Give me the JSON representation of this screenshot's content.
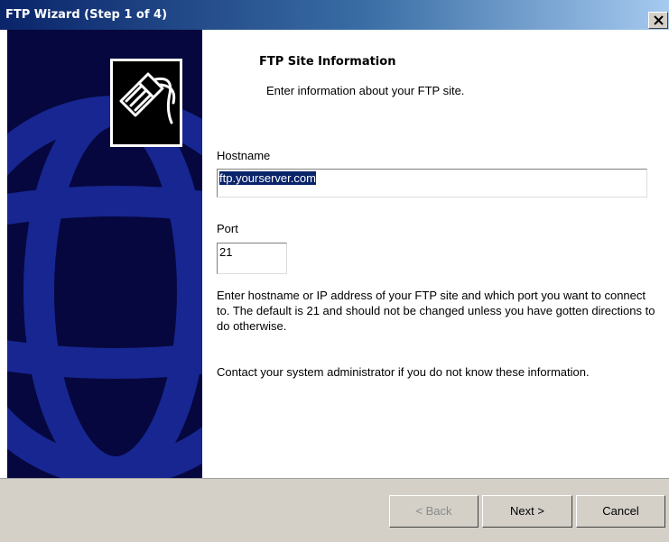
{
  "window": {
    "title": "FTP Wizard (Step 1  of 4)"
  },
  "content": {
    "heading": "FTP Site Information",
    "subheading": "Enter information about your FTP site.",
    "hostname": {
      "label": "Hostname",
      "value": "ftp.yourserver.com"
    },
    "port": {
      "label": "Port",
      "value": "21"
    },
    "help_text": "Enter hostname or IP address of your FTP site and which port  you want to connect to. The default is 21 and should not be changed unless you  have gotten  directions to do otherwise.",
    "contact_text": "Contact your system administrator if you do not know  these information."
  },
  "buttons": {
    "back": "< Back",
    "next": "Next >",
    "cancel": "Cancel"
  },
  "icons": {
    "close": "close-icon",
    "logo": "ftp-plug-logo-icon",
    "background": "globe-graphic"
  },
  "colors": {
    "title_start": "#0a246a",
    "title_end": "#a6caf0",
    "side_panel": "#06073e",
    "selection": "#0a246a",
    "button_face": "#d4d0c8"
  }
}
